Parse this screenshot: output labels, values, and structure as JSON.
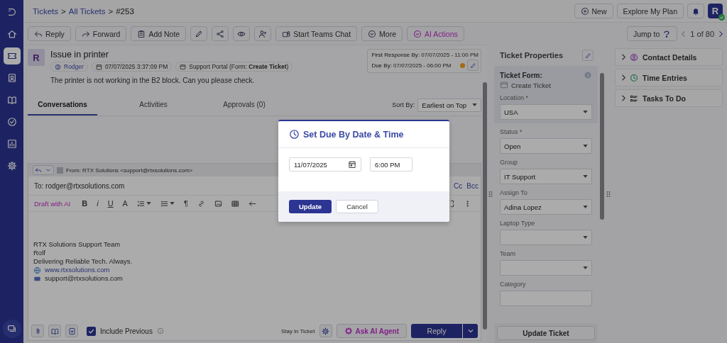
{
  "nav_items": [
    {
      "kind": "home",
      "selected": false
    },
    {
      "kind": "ticket",
      "selected": true
    },
    {
      "kind": "contact",
      "selected": false
    },
    {
      "kind": "book",
      "selected": false
    },
    {
      "kind": "check",
      "selected": false
    },
    {
      "kind": "chart",
      "selected": false
    },
    {
      "kind": "gear",
      "selected": false
    }
  ],
  "breadcrumb": [
    {
      "kind": "link",
      "label": "Tickets"
    },
    {
      "kind": "sep",
      "label": ">"
    },
    {
      "kind": "link",
      "label": "All Tickets"
    },
    {
      "kind": "sep",
      "label": ">"
    },
    {
      "kind": "current",
      "label": "#253"
    }
  ],
  "header_actions": {
    "new": "New",
    "plan": "Explore My Plan",
    "avatar": "R",
    "online": true
  },
  "toolbar": [
    {
      "kind": "reply",
      "label": "Reply"
    },
    {
      "kind": "forward",
      "label": "Forward"
    },
    {
      "kind": "note",
      "label": "Add Note"
    },
    {
      "kind": "pencil"
    },
    {
      "kind": "share"
    },
    {
      "kind": "eye"
    },
    {
      "kind": "user-plus"
    },
    {
      "kind": "teams",
      "label": "Start Teams Chat"
    },
    {
      "kind": "more",
      "label": "More"
    },
    {
      "kind": "ai",
      "label": "AI Actions"
    }
  ],
  "jump_to": "Jump to",
  "pager": "1 of 80",
  "ticket": {
    "avatar": "R",
    "title": "Issue in printer",
    "requester": "Rodger",
    "created": "07/07/2025 3:37:09 PM",
    "source": "Support Portal (Form: **Create Ticket**)",
    "description": "The printer is not working in the B2 block. Can you please check.",
    "first_response_label": "First Response By:",
    "first_response": "07/07/2025 - 11:00 PM",
    "due_label": "Due By:",
    "due": "07/07/2025 - 06:00 PM"
  },
  "tabs": [
    {
      "label": "Conversations",
      "selected": true
    },
    {
      "label": "Activities",
      "selected": false
    },
    {
      "label": "Approvals (0)",
      "selected": false
    }
  ],
  "sort": {
    "label": "Sort By:",
    "value": "Earliest on Top"
  },
  "composer": {
    "from": "From: RTX Solutions <support@rtxsolutions.com>",
    "to": "To: rodger@rtxsolutions.com",
    "cc": "Cc",
    "bcc": "Bcc",
    "draft_ai": "Draft with AI",
    "tools": [
      {
        "kind": "bold",
        "label": "B"
      },
      {
        "kind": "italic",
        "label": "i"
      },
      {
        "kind": "underline",
        "label": "U"
      },
      {
        "kind": "size",
        "label": "A"
      },
      {
        "kind": "ordered-list"
      },
      {
        "kind": "bullet-list"
      },
      {
        "kind": "paragraph",
        "label": "¶"
      },
      {
        "kind": "link"
      },
      {
        "kind": "image"
      },
      {
        "kind": "table"
      },
      {
        "kind": "arrow"
      }
    ],
    "signature": [
      "RTX Solutions Support Team",
      "Rolf",
      "Delivering Reliable Tech. Always."
    ],
    "website": "www.rtxsolutions.com",
    "email": "support@rtxsolutions.com",
    "include_previous": {
      "label": "Include Previous",
      "checked": true
    },
    "stay_label": "Stay in Ticket",
    "ask_ai": "Ask AI Agent",
    "reply": "Reply"
  },
  "properties": {
    "title": "Ticket Properties",
    "form_label": "Ticket Form:",
    "form_value": "Create Ticket",
    "fields": [
      {
        "label": "Location *",
        "value": "USA",
        "kind": "select"
      },
      {
        "label": "Status *",
        "value": "Open",
        "kind": "select"
      },
      {
        "label": "Group",
        "value": "IT Support",
        "kind": "select"
      },
      {
        "label": "Assign To",
        "value": "Adina Lopez",
        "kind": "select"
      },
      {
        "label": "Laptop Type",
        "kind": "select"
      },
      {
        "label": "Team",
        "kind": "select"
      },
      {
        "label": "Category",
        "kind": "text"
      }
    ],
    "update": "Update Ticket"
  },
  "side_panels": [
    {
      "kind": "contact",
      "label": "Contact Details",
      "expanded": false
    },
    {
      "kind": "clock",
      "label": "Time Entries",
      "expanded": false
    },
    {
      "kind": "tasks",
      "label": "Tasks To Do",
      "expanded": false
    }
  ],
  "modal": {
    "title": "Set Due By Date & Time",
    "date": "11/07/2025",
    "time": "6:00 PM",
    "update": "Update",
    "cancel": "Cancel"
  }
}
